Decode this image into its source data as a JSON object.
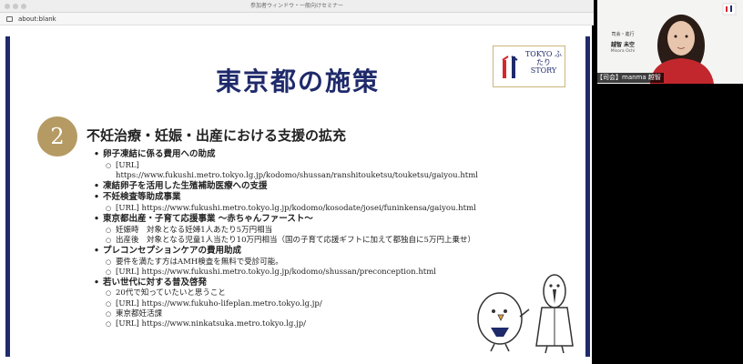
{
  "window": {
    "title": "参加者ウィンドウ・一般向けセミナー",
    "url": "about:blank"
  },
  "slide": {
    "title": "東京都の施策",
    "logo_text": "TOKYO ふたり STORY",
    "section_number": "2",
    "section_title": "不妊治療・妊娠・出産における支援の拡充",
    "items": [
      {
        "label": "卵子凍結に係る費用への助成",
        "subs": [
          "[URL] https://www.fukushi.metro.tokyo.lg.jp/kodomo/shussan/ranshitouketsu/touketsu/gaiyou.html"
        ]
      },
      {
        "label": "凍結卵子を活用した生殖補助医療への支援",
        "subs": []
      },
      {
        "label": "不妊検査等助成事業",
        "subs": [
          "[URL] https://www.fukushi.metro.tokyo.lg.jp/kodomo/kosodate/josei/funinkensa/gaiyou.html"
        ]
      },
      {
        "label": "東京都出産・子育て応援事業 〜赤ちゃんファースト〜",
        "subs": [
          "妊娠時　対象となる妊婦1人あたり5万円相当",
          "出産後　対象となる児童1人当たり10万円相当（国の子育て応援ギフトに加えて都独自に5万円上乗せ）"
        ]
      },
      {
        "label": "プレコンセプションケアの費用助成",
        "subs": [
          "要件を満たす方はAMH検査を無料で受診可能。",
          "[URL] https://www.fukushi.metro.tokyo.lg.jp/kodomo/shussan/preconception.html"
        ]
      },
      {
        "label": "若い世代に対する普及啓発",
        "subs": [
          "20代で知っていたいと思うこと",
          "[URL] https://www.fukuho-lifeplan.metro.tokyo.lg.jp/",
          "東京都妊活課",
          "[URL] https://www.ninkatsuka.metro.tokyo.lg.jp/"
        ]
      }
    ]
  },
  "participant": {
    "role": "司会・進行",
    "name": "越智 未空",
    "name_en": "Misora Ochi",
    "label": "【司会】manma 越智"
  },
  "colors": {
    "slide_accent": "#1f2a6b",
    "number_circle": "#b59a63"
  }
}
